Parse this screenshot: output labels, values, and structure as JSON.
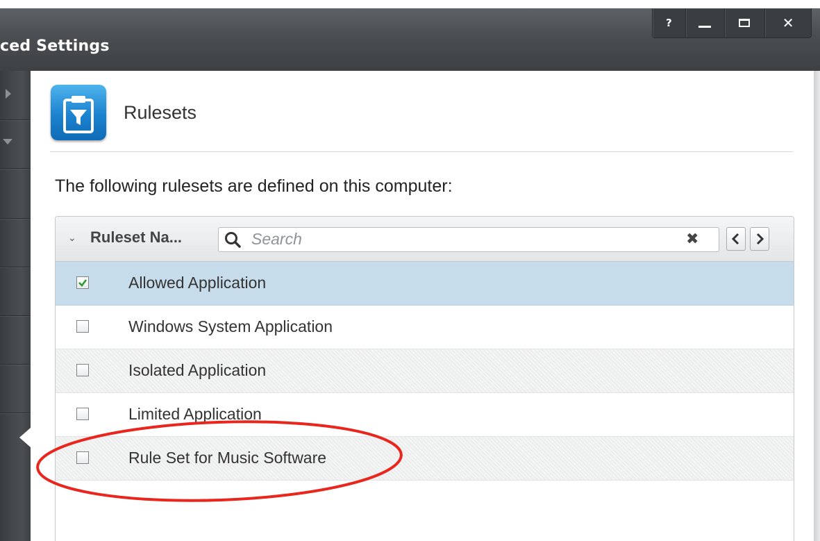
{
  "window": {
    "title": "ced Settings",
    "controls": {
      "help": "?",
      "close": "✕"
    }
  },
  "section": {
    "title": "Rulesets",
    "description": "The following rulesets are defined on this computer:"
  },
  "table": {
    "column_header": "Ruleset Na...",
    "search_placeholder": "Search",
    "rows": [
      {
        "label": "Allowed Application",
        "checked": true,
        "selected": true
      },
      {
        "label": "Windows System Application",
        "checked": false,
        "selected": false
      },
      {
        "label": "Isolated Application",
        "checked": false,
        "selected": false
      },
      {
        "label": "Limited Application",
        "checked": false,
        "selected": false
      },
      {
        "label": "Rule Set for Music Software",
        "checked": false,
        "selected": false
      }
    ]
  },
  "colors": {
    "titlebar": "#4a4e52",
    "selected_row": "#c7dcea",
    "icon_blue": "#1b82cf",
    "highlight_ellipse": "#e8261d"
  },
  "icons": {
    "header_icon": "clipboard-filter-icon",
    "search": "search-icon",
    "clear": "clear-icon",
    "prev": "chevron-left-icon",
    "next": "chevron-right-icon"
  }
}
